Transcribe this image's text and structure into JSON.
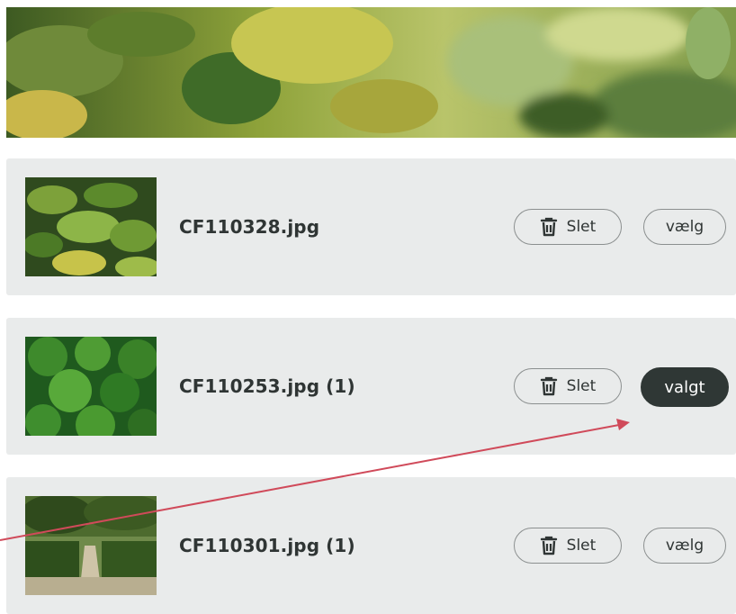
{
  "hero": {
    "image": "sage-leaves-banner"
  },
  "files": [
    {
      "name": "CF110328.jpg",
      "delete_label": "Slet",
      "select_label": "vælg",
      "selected": false,
      "thumbnail": "sage-leaves"
    },
    {
      "name": "CF110253.jpg (1)",
      "delete_label": "Slet",
      "select_label": "valgt",
      "selected": true,
      "thumbnail": "lady-mantle-leaves"
    },
    {
      "name": "CF110301.jpg (1)",
      "delete_label": "Slet",
      "select_label": "vælg",
      "selected": false,
      "thumbnail": "hedge-garden"
    }
  ],
  "icons": {
    "delete": "trash-icon"
  },
  "colors": {
    "row_bg": "#e9ebeb",
    "selected_bg": "#2f3735",
    "text": "#2f3534",
    "annotation_arrow": "#d04a5a"
  }
}
